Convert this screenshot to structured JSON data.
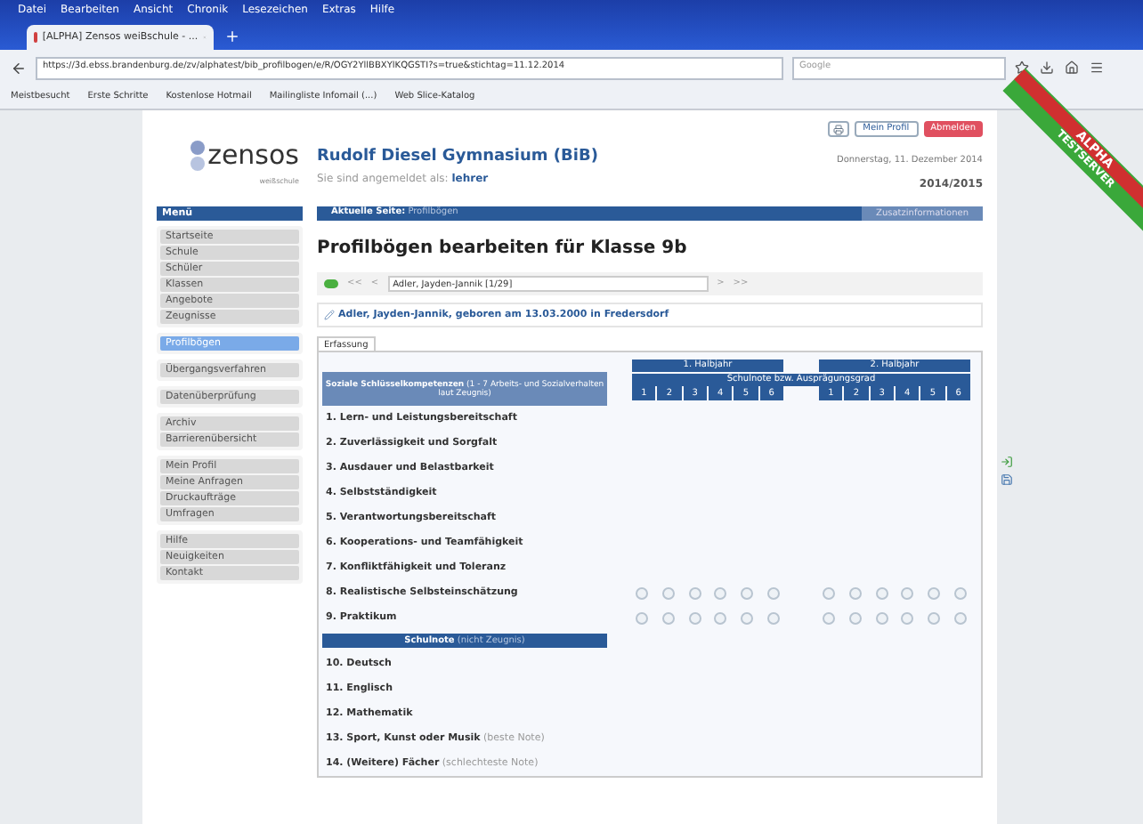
{
  "browser": {
    "menu": [
      "Datei",
      "Bearbeiten",
      "Ansicht",
      "Chronik",
      "Lesezeichen",
      "Extras",
      "Hilfe"
    ],
    "tab": {
      "title": "[ALPHA] Zensos weiBschule - ..."
    },
    "url": "https://3d.ebss.brandenburg.de/zv/alphatest/bib_profilbogen/e/R/OGY2YllBBXYlKQGSTI?s=true&stichtag=11.12.2014",
    "search": {
      "placeholder": "Google"
    },
    "bookmarks": [
      "Meistbesucht",
      "Erste Schritte",
      "Kostenlose Hotmail",
      "Mailingliste Infomail (...)",
      "Web Slice-Katalog"
    ]
  },
  "ribbon": {
    "line1": "ALPHA",
    "line2": "TESTSERVER"
  },
  "header": {
    "logo": "zensos",
    "logo_sub": "weißschule",
    "school": "Rudolf Diesel Gymnasium (BiB)",
    "login_prefix": "Sie sind angemeldet als:",
    "login_user": "lehrer",
    "buttons": [
      "Mein Profil",
      "Abmelden"
    ],
    "date": "Donnerstag, 11. Dezember 2014",
    "year": "2014/2015"
  },
  "menu_title": "Menü",
  "sidebar": [
    [
      {
        "label": "Startseite",
        "selected": false
      },
      {
        "label": "Schule",
        "selected": false
      },
      {
        "label": "Schüler",
        "selected": false
      },
      {
        "label": "Klassen",
        "selected": false
      },
      {
        "label": "Angebote",
        "selected": false
      },
      {
        "label": "Zeugnisse",
        "selected": false
      }
    ],
    [
      {
        "label": "Profilbögen",
        "selected": true
      }
    ],
    [
      {
        "label": "Übergangsverfahren",
        "selected": false
      }
    ],
    [
      {
        "label": "Datenüberprüfung",
        "selected": false
      }
    ],
    [
      {
        "label": "Archiv",
        "selected": false
      },
      {
        "label": "Barrierenübersicht",
        "selected": false
      }
    ],
    [
      {
        "label": "Mein Profil",
        "selected": false
      },
      {
        "label": "Meine Anfragen",
        "selected": false
      },
      {
        "label": "Druckaufträge",
        "selected": false
      },
      {
        "label": "Umfragen",
        "selected": false
      }
    ],
    [
      {
        "label": "Hilfe",
        "selected": false
      },
      {
        "label": "Neuigkeiten",
        "selected": false
      },
      {
        "label": "Kontakt",
        "selected": false
      }
    ]
  ],
  "breadcrumb": {
    "prefix": "Aktuelle Seite:",
    "page": "Profilbögen",
    "extra": "Zusatzinformationen"
  },
  "title": "Profilbögen bearbeiten für Klasse 9b",
  "navigator": {
    "first": "<<",
    "prev": "<",
    "student": "Adler, Jayden-Jannik [1/29]",
    "next": ">",
    "last": ">>"
  },
  "student_line": "Adler, Jayden-Jannik, geboren am 13.03.2000 in Fredersdorf",
  "tabs": [
    {
      "label": "Erfassung",
      "selected": true
    }
  ],
  "table": {
    "halves": [
      "1. Halbjahr",
      "2. Halbjahr"
    ],
    "group_header": "Schulnote bzw. Ausprägungsgrad",
    "grades": [
      [
        "1",
        "2",
        "3",
        "4",
        "5",
        "6"
      ],
      [
        "1",
        "2",
        "3",
        "4",
        "5",
        "6"
      ]
    ],
    "first_header": {
      "bold": "Soziale Schlüsselkompetenzen",
      "rest": "(1 - 7 Arbeits- und Sozialverhalten laut Zeugnis)"
    },
    "rows": [
      {
        "kind": "item",
        "label": "1. Lern- und Leistungsbereitschaft",
        "options": false
      },
      {
        "kind": "item",
        "label": "2. Zuverlässigkeit und Sorgfalt",
        "options": false
      },
      {
        "kind": "item",
        "label": "3. Ausdauer und Belastbarkeit",
        "options": false
      },
      {
        "kind": "item",
        "label": "4. Selbstständigkeit",
        "options": false
      },
      {
        "kind": "item",
        "label": "5. Verantwortungsbereitschaft",
        "options": false
      },
      {
        "kind": "item",
        "label": "6. Kooperations- und Teamfähigkeit",
        "options": false
      },
      {
        "kind": "item",
        "label": "7. Konfliktfähigkeit und Toleranz",
        "options": false
      },
      {
        "kind": "item",
        "label": "8. Realistische Selbsteinschätzung",
        "options": true
      },
      {
        "kind": "item",
        "label": "9. Praktikum",
        "options": true
      },
      {
        "kind": "section",
        "label": "Schulnote",
        "note": "(nicht Zeugnis)"
      },
      {
        "kind": "item",
        "label": "10. Deutsch",
        "options": false
      },
      {
        "kind": "item",
        "label": "11. Englisch",
        "options": false
      },
      {
        "kind": "item",
        "label": "12. Mathematik",
        "options": false
      },
      {
        "kind": "item",
        "label": "13. Sport, Kunst oder Musik",
        "note": "(beste Note)",
        "options": false
      },
      {
        "kind": "item",
        "label": "14. (Weitere) Fächer",
        "note": "(schlechteste Note)",
        "options": false
      }
    ]
  }
}
